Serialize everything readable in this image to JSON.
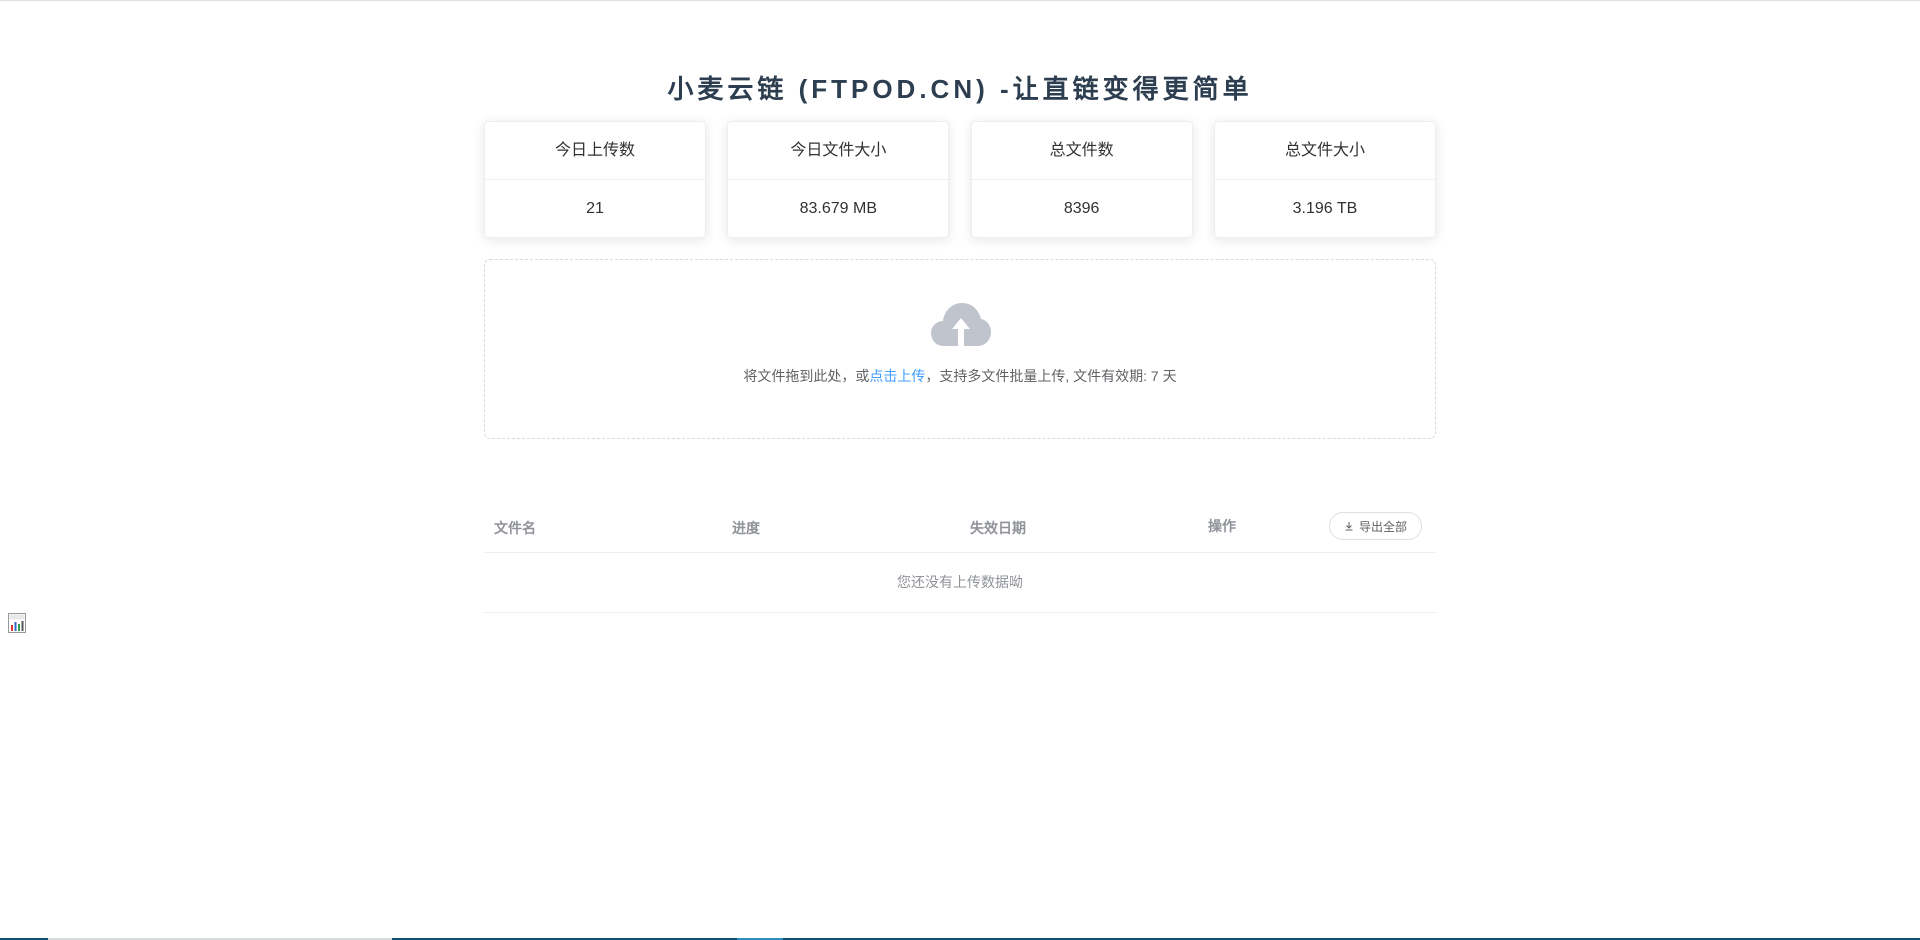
{
  "page_title": "小麦云链 (FTPOD.CN) -让直链变得更简单",
  "stats": [
    {
      "label": "今日上传数",
      "value": "21"
    },
    {
      "label": "今日文件大小",
      "value": "83.679 MB"
    },
    {
      "label": "总文件数",
      "value": "8396"
    },
    {
      "label": "总文件大小",
      "value": "3.196 TB"
    }
  ],
  "upload": {
    "icon": "cloud-upload-icon",
    "text_before": "将文件拖到此处，或",
    "link_text": "点击上传",
    "text_after": "，支持多文件批量上传, 文件有效期: 7 天"
  },
  "table": {
    "columns": {
      "name": "文件名",
      "progress": "进度",
      "expire": "失效日期",
      "action": "操作"
    },
    "export_label": "导出全部",
    "empty_text": "您还没有上传数据呦"
  },
  "colors": {
    "accent": "#409eff",
    "title": "#2c3e50",
    "muted": "#909399"
  }
}
